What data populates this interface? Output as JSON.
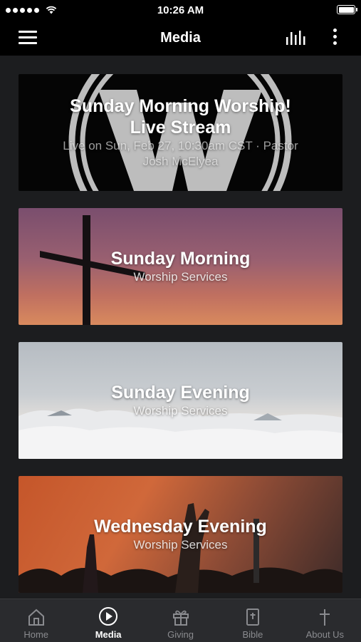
{
  "status_bar": {
    "time": "10:26 AM",
    "signal_dots": 5,
    "battery_level": 0.9
  },
  "nav": {
    "title": "Media"
  },
  "cards": [
    {
      "title": "Sunday Morning Worship! Live Stream",
      "subtitle": "Live on Sun, Feb 27, 10:30am CST · Pastor Josh McElyea"
    },
    {
      "title": "Sunday Morning",
      "subtitle": "Worship Services"
    },
    {
      "title": "Sunday Evening",
      "subtitle": "Worship Services"
    },
    {
      "title": "Wednesday Evening",
      "subtitle": "Worship Services"
    }
  ],
  "tabs": [
    {
      "label": "Home",
      "icon": "home-icon",
      "active": false
    },
    {
      "label": "Media",
      "icon": "play-circle-icon",
      "active": true
    },
    {
      "label": "Giving",
      "icon": "gift-icon",
      "active": false
    },
    {
      "label": "Bible",
      "icon": "bible-icon",
      "active": false
    },
    {
      "label": "About Us",
      "icon": "cross-icon",
      "active": false
    }
  ],
  "colors": {
    "background": "#1c1d1f",
    "bars": "#000000",
    "tab_bar": "#2a2b2e",
    "tab_inactive": "#8a8b8f",
    "tab_active": "#ffffff"
  }
}
